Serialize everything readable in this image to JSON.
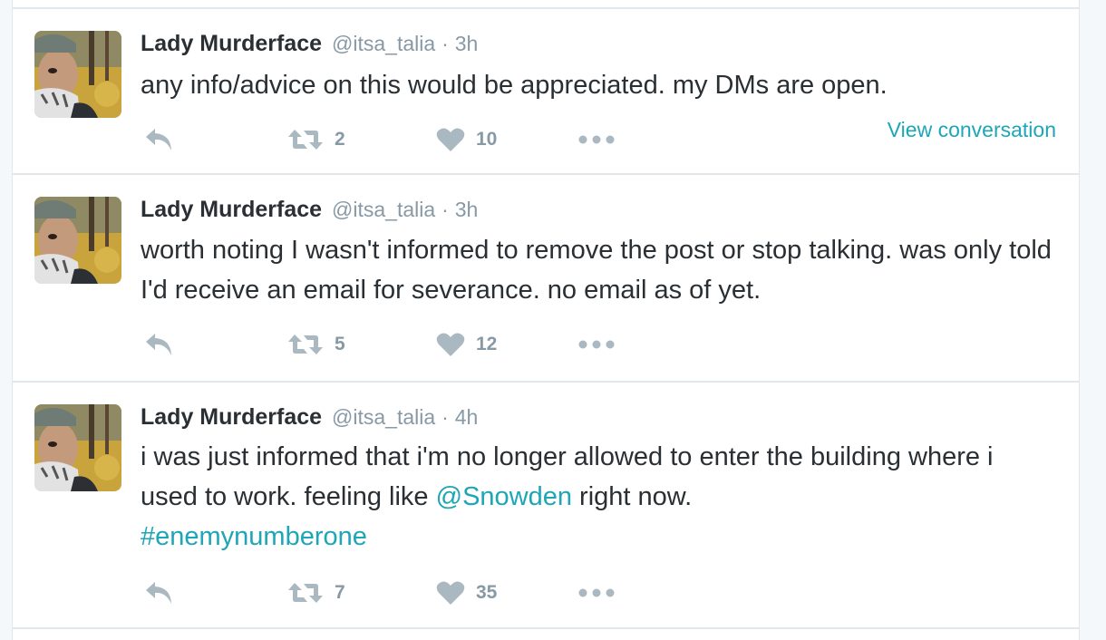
{
  "colors": {
    "link": "#1da6b6",
    "text": "#292f33",
    "muted": "#8899a6",
    "icon": "#aab8c2",
    "border": "#e1e8ed"
  },
  "icons": {
    "reply": "reply-icon",
    "retweet": "retweet-icon",
    "like": "heart-icon",
    "more": "more-icon"
  },
  "tweets": [
    {
      "name": "Lady Murderface",
      "handle": "@itsa_talia",
      "dot": "·",
      "time": "3h",
      "text": "any info/advice on this would be appreciated. my DMs are open.",
      "retweets": "2",
      "likes": "10",
      "view_conversation": "View conversation"
    },
    {
      "name": "Lady Murderface",
      "handle": "@itsa_talia",
      "dot": "·",
      "time": "3h",
      "text": "worth noting I wasn't informed to remove the post or stop talking. was only told I'd receive an email for severance. no email as of yet.",
      "retweets": "5",
      "likes": "12"
    },
    {
      "name": "Lady Murderface",
      "handle": "@itsa_talia",
      "dot": "·",
      "time": "4h",
      "text_before": "i was just informed that i'm no longer allowed to enter the building where i used to work. feeling like ",
      "mention": "@Snowden",
      "text_after": " right now.",
      "hashtag": "#enemynumberone",
      "retweets": "7",
      "likes": "35"
    }
  ]
}
